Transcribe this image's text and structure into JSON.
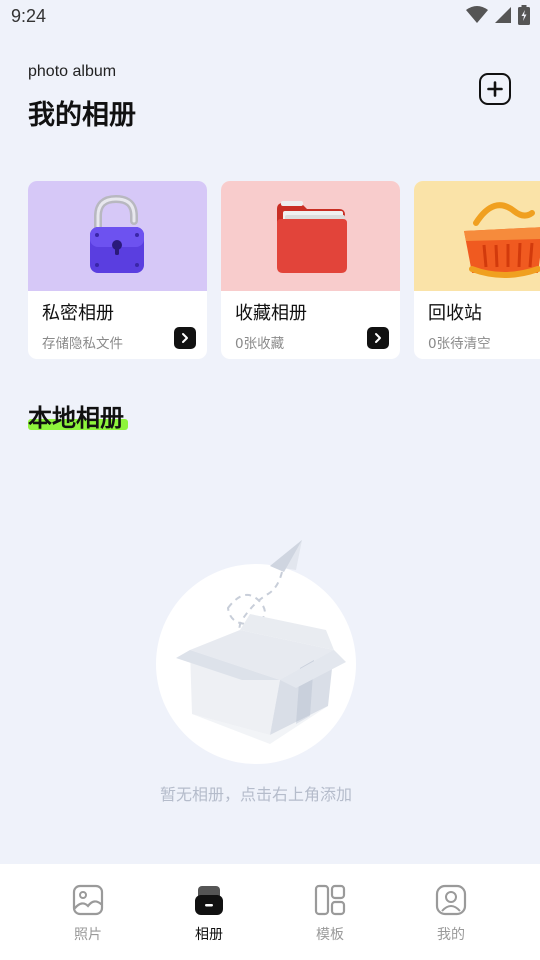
{
  "status": {
    "time": "9:24"
  },
  "header": {
    "subtitle": "photo album",
    "title": "我的相册"
  },
  "cards": [
    {
      "title": "私密相册",
      "desc": "存储隐私文件",
      "bg": "#d6c8f7"
    },
    {
      "title": "收藏相册",
      "desc": "0张收藏",
      "bg": "#f8cccc"
    },
    {
      "title": "回收站",
      "desc": "0张待清空",
      "bg": "#fae3a8"
    }
  ],
  "section": {
    "title": "本地相册"
  },
  "empty": {
    "text": "暂无相册，点击右上角添加"
  },
  "nav": [
    {
      "label": "照片",
      "icon": "photo-icon",
      "active": false
    },
    {
      "label": "相册",
      "icon": "album-icon",
      "active": true
    },
    {
      "label": "模板",
      "icon": "template-icon",
      "active": false
    },
    {
      "label": "我的",
      "icon": "profile-icon",
      "active": false
    }
  ],
  "colors": {
    "accent_underline": "#8ef43c",
    "background": "#eff2fa"
  }
}
